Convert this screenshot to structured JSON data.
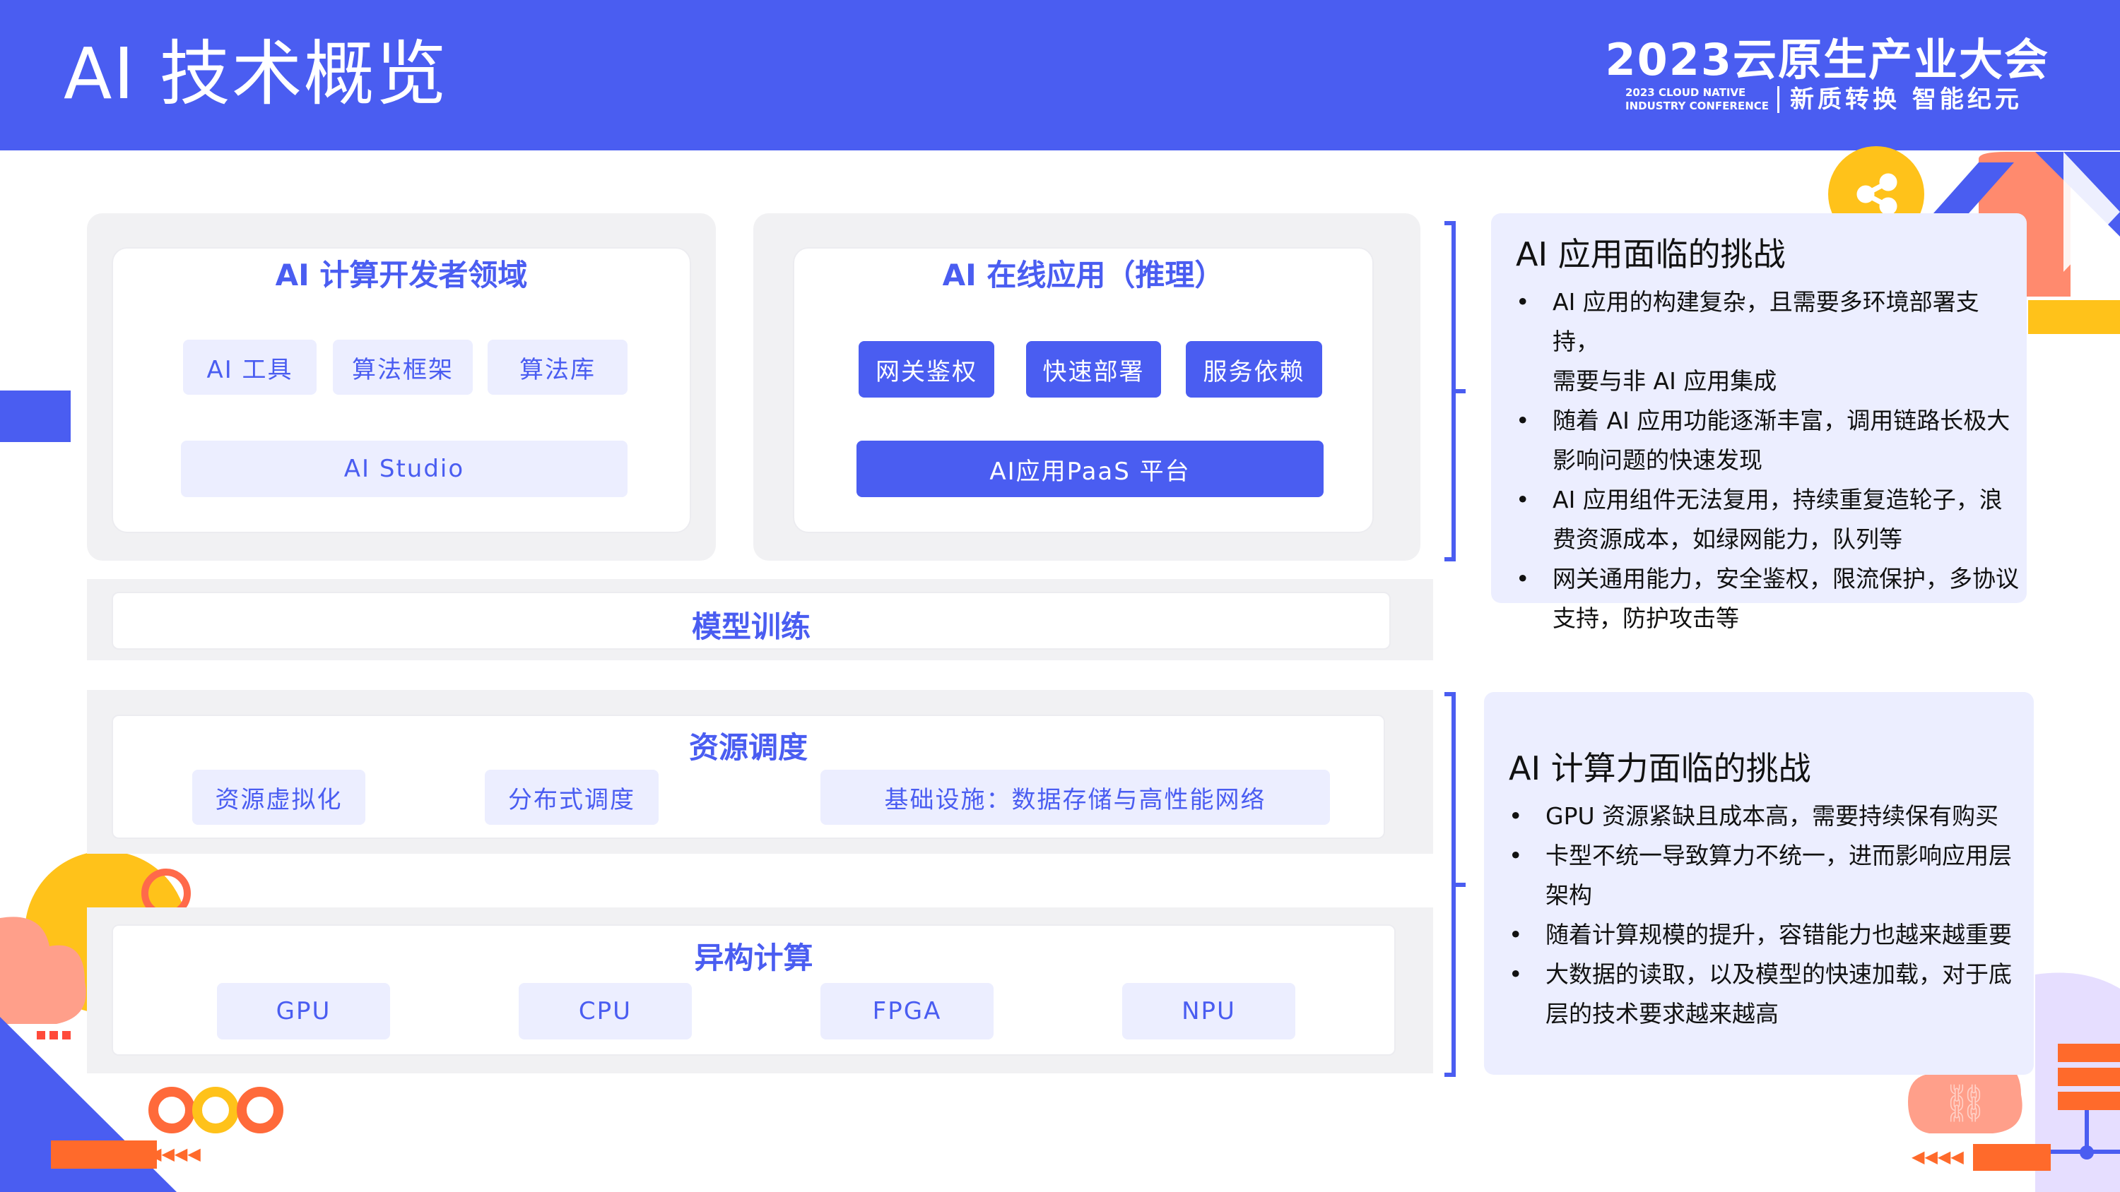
{
  "header": {
    "title": "AI 技术概览",
    "conference_title": "2023云原生产业大会",
    "conference_en_line1": "2023 CLOUD NATIVE",
    "conference_en_line2": "INDUSTRY CONFERENCE",
    "conference_slogan": "新质转换 智能纪元"
  },
  "dev_domain": {
    "title": "AI 计算开发者领域",
    "chips": [
      "AI 工具",
      "算法框架",
      "算法库"
    ],
    "platform": "AI Studio"
  },
  "online_app": {
    "title": "AI 在线应用（推理）",
    "chips": [
      "网关鉴权",
      "快速部署",
      "服务依赖"
    ],
    "platform": "AI应用PaaS 平台"
  },
  "model_training": {
    "title": "模型训练"
  },
  "resource_scheduling": {
    "title": "资源调度",
    "chips": [
      "资源虚拟化",
      "分布式调度",
      "基础设施：数据存储与高性能网络"
    ]
  },
  "heterogeneous": {
    "title": "异构计算",
    "chips": [
      "GPU",
      "CPU",
      "FPGA",
      "NPU"
    ]
  },
  "app_challenges": {
    "title": "AI 应用面临的挑战",
    "items": [
      {
        "line1": "AI 应用的构建复杂，且需要多环境部署支持，",
        "line2": "需要与非 AI 应用集成"
      },
      {
        "line1": "随着 AI 应用功能逐渐丰富，调用链路长极大",
        "line2": "影响问题的快速发现"
      },
      {
        "line1": " AI 应用组件无法复用，持续重复造轮子，浪",
        "line2": "费资源成本，如绿网能力，队列等"
      },
      {
        "line1": "网关通用能力，安全鉴权，限流保护，多协议",
        "line2": "支持，防护攻击等"
      }
    ]
  },
  "compute_challenges": {
    "title": "AI 计算力面临的挑战",
    "items": [
      {
        "line1": "GPU 资源紧缺且成本高，需要持续保有购买",
        "line2": ""
      },
      {
        "line1": "卡型不统一导致算力不统一，进而影响应用层",
        "line2": "架构"
      },
      {
        "line1": "随着计算规模的提升，容错能力也越来越重要",
        "line2": ""
      },
      {
        "line1": "大数据的读取，以及模型的快速加载，对于底",
        "line2": "层的技术要求越来越高"
      }
    ]
  },
  "colors": {
    "brand_blue": "#4a5df1",
    "chip_light": "#eceeff",
    "panel_gray": "#f1f1f3",
    "accent_orange": "#ff6a2b",
    "accent_yellow": "#ffc21a",
    "accent_pink": "#ff8a7a"
  }
}
